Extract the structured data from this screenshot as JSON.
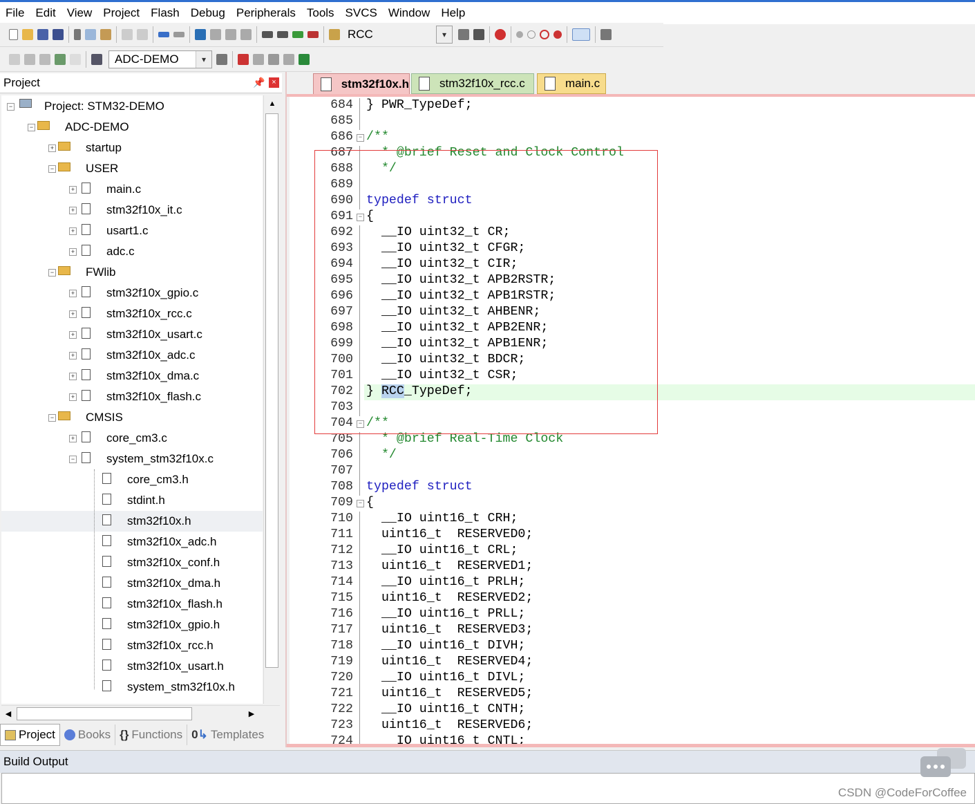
{
  "menu": [
    "File",
    "Edit",
    "View",
    "Project",
    "Flash",
    "Debug",
    "Peripherals",
    "Tools",
    "SVCS",
    "Window",
    "Help"
  ],
  "toolbar1": {
    "target_combo": "RCC"
  },
  "toolbar2": {
    "target_select": "ADC-DEMO"
  },
  "project_pane": {
    "title": "Project",
    "tree": [
      {
        "label": "Project: STM32-DEMO",
        "level": 0,
        "kind": "root",
        "expander": "-"
      },
      {
        "label": "ADC-DEMO",
        "level": 1,
        "kind": "group",
        "expander": "-"
      },
      {
        "label": "startup",
        "level": 2,
        "kind": "folder",
        "expander": "+"
      },
      {
        "label": "USER",
        "level": 2,
        "kind": "folder",
        "expander": "-"
      },
      {
        "label": "main.c",
        "level": 3,
        "kind": "file",
        "expander": "+"
      },
      {
        "label": "stm32f10x_it.c",
        "level": 3,
        "kind": "file",
        "expander": "+"
      },
      {
        "label": "usart1.c",
        "level": 3,
        "kind": "file",
        "expander": "+"
      },
      {
        "label": "adc.c",
        "level": 3,
        "kind": "file",
        "expander": "+"
      },
      {
        "label": "FWlib",
        "level": 2,
        "kind": "folder",
        "expander": "-"
      },
      {
        "label": "stm32f10x_gpio.c",
        "level": 3,
        "kind": "file",
        "expander": "+"
      },
      {
        "label": "stm32f10x_rcc.c",
        "level": 3,
        "kind": "file",
        "expander": "+"
      },
      {
        "label": "stm32f10x_usart.c",
        "level": 3,
        "kind": "file",
        "expander": "+"
      },
      {
        "label": "stm32f10x_adc.c",
        "level": 3,
        "kind": "file",
        "expander": "+"
      },
      {
        "label": "stm32f10x_dma.c",
        "level": 3,
        "kind": "file",
        "expander": "+"
      },
      {
        "label": "stm32f10x_flash.c",
        "level": 3,
        "kind": "file",
        "expander": "+"
      },
      {
        "label": "CMSIS",
        "level": 2,
        "kind": "folder",
        "expander": "-"
      },
      {
        "label": "core_cm3.c",
        "level": 3,
        "kind": "file",
        "expander": "+"
      },
      {
        "label": "system_stm32f10x.c",
        "level": 3,
        "kind": "file",
        "expander": "-"
      },
      {
        "label": "core_cm3.h",
        "level": 4,
        "kind": "file",
        "expander": ""
      },
      {
        "label": "stdint.h",
        "level": 4,
        "kind": "file",
        "expander": ""
      },
      {
        "label": "stm32f10x.h",
        "level": 4,
        "kind": "file",
        "expander": "",
        "selected": true
      },
      {
        "label": "stm32f10x_adc.h",
        "level": 4,
        "kind": "file",
        "expander": ""
      },
      {
        "label": "stm32f10x_conf.h",
        "level": 4,
        "kind": "file",
        "expander": ""
      },
      {
        "label": "stm32f10x_dma.h",
        "level": 4,
        "kind": "file",
        "expander": ""
      },
      {
        "label": "stm32f10x_flash.h",
        "level": 4,
        "kind": "file",
        "expander": ""
      },
      {
        "label": "stm32f10x_gpio.h",
        "level": 4,
        "kind": "file",
        "expander": ""
      },
      {
        "label": "stm32f10x_rcc.h",
        "level": 4,
        "kind": "file",
        "expander": ""
      },
      {
        "label": "stm32f10x_usart.h",
        "level": 4,
        "kind": "file",
        "expander": ""
      },
      {
        "label": "system_stm32f10x.h",
        "level": 4,
        "kind": "file",
        "expander": ""
      }
    ],
    "tabs": [
      "Project",
      "Books",
      "Functions",
      "Templates"
    ]
  },
  "editor": {
    "tabs": [
      "stm32f10x.h",
      "stm32f10x_rcc.c",
      "main.c"
    ],
    "selected_word": "RCC",
    "lines": [
      {
        "n": "684",
        "t": "} PWR_TypeDef;"
      },
      {
        "n": "685",
        "t": ""
      },
      {
        "n": "686",
        "t": "/**",
        "c": 1,
        "fold": 1
      },
      {
        "n": "687",
        "t": "  * @brief Reset and Clock Control",
        "c": 1
      },
      {
        "n": "688",
        "t": "  */",
        "c": 1
      },
      {
        "n": "689",
        "t": ""
      },
      {
        "n": "690",
        "t": "typedef struct",
        "k": 1
      },
      {
        "n": "691",
        "t": "{",
        "fold": 1
      },
      {
        "n": "692",
        "t": "  __IO uint32_t CR;"
      },
      {
        "n": "693",
        "t": "  __IO uint32_t CFGR;"
      },
      {
        "n": "694",
        "t": "  __IO uint32_t CIR;"
      },
      {
        "n": "695",
        "t": "  __IO uint32_t APB2RSTR;"
      },
      {
        "n": "696",
        "t": "  __IO uint32_t APB1RSTR;"
      },
      {
        "n": "697",
        "t": "  __IO uint32_t AHBENR;"
      },
      {
        "n": "698",
        "t": "  __IO uint32_t APB2ENR;"
      },
      {
        "n": "699",
        "t": "  __IO uint32_t APB1ENR;"
      },
      {
        "n": "700",
        "t": "  __IO uint32_t BDCR;"
      },
      {
        "n": "701",
        "t": "  __IO uint32_t CSR;"
      },
      {
        "n": "702",
        "t": "} RCC_TypeDef;",
        "hl": 1,
        "sel": 1
      },
      {
        "n": "703",
        "t": ""
      },
      {
        "n": "704",
        "t": "/**",
        "c": 1,
        "fold": 1
      },
      {
        "n": "705",
        "t": "  * @brief Real-Time Clock",
        "c": 1
      },
      {
        "n": "706",
        "t": "  */",
        "c": 1
      },
      {
        "n": "707",
        "t": ""
      },
      {
        "n": "708",
        "t": "typedef struct",
        "k": 1
      },
      {
        "n": "709",
        "t": "{",
        "fold": 1
      },
      {
        "n": "710",
        "t": "  __IO uint16_t CRH;"
      },
      {
        "n": "711",
        "t": "  uint16_t  RESERVED0;"
      },
      {
        "n": "712",
        "t": "  __IO uint16_t CRL;"
      },
      {
        "n": "713",
        "t": "  uint16_t  RESERVED1;"
      },
      {
        "n": "714",
        "t": "  __IO uint16_t PRLH;"
      },
      {
        "n": "715",
        "t": "  uint16_t  RESERVED2;"
      },
      {
        "n": "716",
        "t": "  __IO uint16_t PRLL;"
      },
      {
        "n": "717",
        "t": "  uint16_t  RESERVED3;"
      },
      {
        "n": "718",
        "t": "  __IO uint16_t DIVH;"
      },
      {
        "n": "719",
        "t": "  uint16_t  RESERVED4;"
      },
      {
        "n": "720",
        "t": "  __IO uint16_t DIVL;"
      },
      {
        "n": "721",
        "t": "  uint16_t  RESERVED5;"
      },
      {
        "n": "722",
        "t": "  __IO uint16_t CNTH;"
      },
      {
        "n": "723",
        "t": "  uint16_t  RESERVED6;"
      },
      {
        "n": "724",
        "t": "  __IO uint16_t CNTL;"
      }
    ]
  },
  "build_output": {
    "title": "Build Output"
  },
  "watermark": "CSDN @CodeForCoffee",
  "colors": {
    "keyword": "#2020c0",
    "comment": "#22882e",
    "highlight": "#e6fce6",
    "annotation_box": "#e23b3b",
    "active_tab": "#f5c6c6"
  }
}
